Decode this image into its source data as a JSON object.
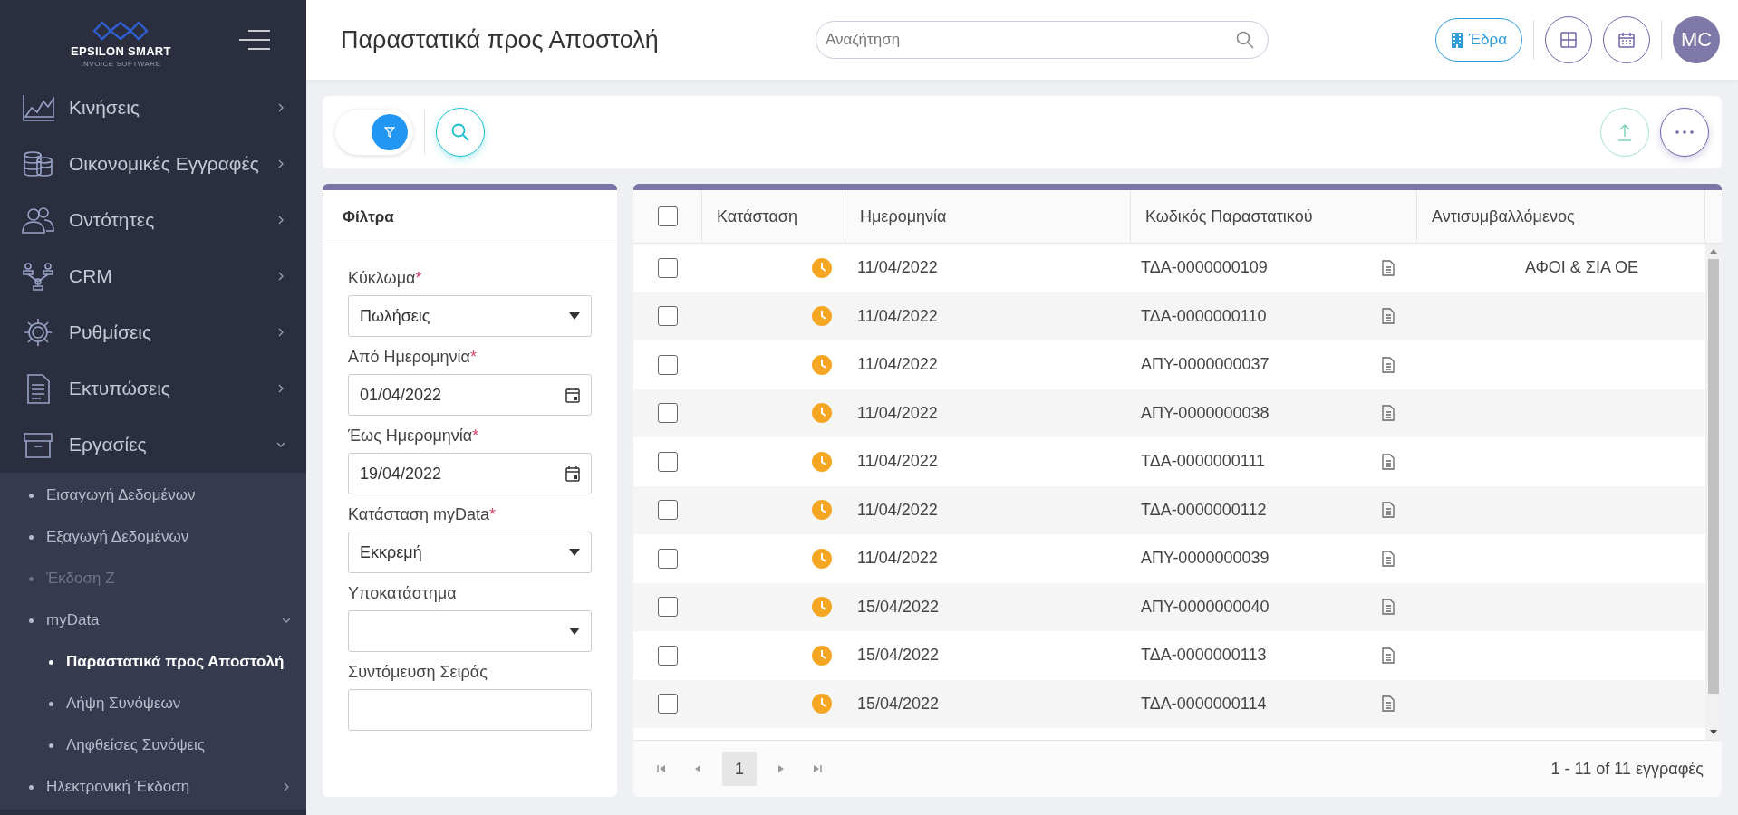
{
  "sidebar": {
    "logo": {
      "title": "EPSILON SMART",
      "subtitle": "INVOICE SOFTWARE"
    },
    "items": [
      {
        "label": "Κινήσεις",
        "kind": "chart",
        "expanded": false
      },
      {
        "label": "Οικονομικές Εγγραφές",
        "kind": "coins",
        "expanded": false
      },
      {
        "label": "Οντότητες",
        "kind": "people",
        "expanded": false
      },
      {
        "label": "CRM",
        "kind": "network",
        "expanded": false
      },
      {
        "label": "Ρυθμίσεις",
        "kind": "gear",
        "expanded": false
      },
      {
        "label": "Εκτυπώσεις",
        "kind": "document",
        "expanded": false
      },
      {
        "label": "Εργασίες",
        "kind": "archive",
        "expanded": true,
        "children": [
          {
            "label": "Εισαγωγή Δεδομένων",
            "disabled": false,
            "selected": false
          },
          {
            "label": "Εξαγωγή Δεδομένων",
            "disabled": false,
            "selected": false
          },
          {
            "label": "Έκδοση Ζ",
            "disabled": true,
            "selected": false
          },
          {
            "label": "myData",
            "disabled": false,
            "selected": false,
            "expanded": true,
            "children": [
              {
                "label": "Παραστατικά προς Αποστολή",
                "selected": true
              },
              {
                "label": "Λήψη Συνόψεων",
                "selected": false
              },
              {
                "label": "Ληφθείσες Συνόψεις",
                "selected": false
              }
            ]
          },
          {
            "label": "Ηλεκτρονική Έκδοση",
            "disabled": false,
            "selected": false,
            "expanded": false
          }
        ]
      }
    ]
  },
  "header": {
    "title": "Παραστατικά προς Αποστολή",
    "search": {
      "placeholder": "Αναζήτηση"
    },
    "branch_button": "Έδρα",
    "avatar": "MC"
  },
  "toolbar": {
    "filter_toggle": {
      "on": true
    }
  },
  "filters": {
    "title": "Φίλτρα",
    "fields": [
      {
        "kind": "select",
        "label": "Κύκλωμα",
        "required_mark": "*",
        "value": "Πωλήσεις"
      },
      {
        "kind": "date",
        "label": "Από Ημερομηνία",
        "required_mark": "*",
        "value": "01/04/2022"
      },
      {
        "kind": "date",
        "label": "Έως Ημερομηνία",
        "required_mark": "*",
        "value": "19/04/2022"
      },
      {
        "kind": "select",
        "label": "Κατάσταση myData",
        "required_mark": "*",
        "value": "Εκκρεμή"
      },
      {
        "kind": "select",
        "label": "Υποκατάστημα"
      },
      {
        "kind": "text",
        "label": "Συντόμευση Σειράς"
      }
    ]
  },
  "table": {
    "select_all": {
      "checked": false
    },
    "columns": [
      "Κατάσταση",
      "Ημερομηνία",
      "Κωδικός Παραστατικού",
      "Αντισυμβαλλόμενος"
    ],
    "rows": [
      {
        "checked": false,
        "kind": "pending",
        "date": "11/04/2022",
        "code": "ΤΔΑ-0000000109",
        "counterparty": "ΑΦΟΙ & ΣΙΑ ΟΕ"
      },
      {
        "checked": false,
        "kind": "pending",
        "date": "11/04/2022",
        "code": "ΤΔΑ-0000000110"
      },
      {
        "checked": false,
        "kind": "pending",
        "date": "11/04/2022",
        "code": "ΑΠΥ-0000000037"
      },
      {
        "checked": false,
        "kind": "pending",
        "date": "11/04/2022",
        "code": "ΑΠΥ-0000000038"
      },
      {
        "checked": false,
        "kind": "pending",
        "date": "11/04/2022",
        "code": "ΤΔΑ-0000000111"
      },
      {
        "checked": false,
        "kind": "pending",
        "date": "11/04/2022",
        "code": "ΤΔΑ-0000000112"
      },
      {
        "checked": false,
        "kind": "pending",
        "date": "11/04/2022",
        "code": "ΑΠΥ-0000000039"
      },
      {
        "checked": false,
        "kind": "pending",
        "date": "15/04/2022",
        "code": "ΑΠΥ-0000000040"
      },
      {
        "checked": false,
        "kind": "pending",
        "date": "15/04/2022",
        "code": "ΤΔΑ-0000000113"
      },
      {
        "checked": false,
        "kind": "pending",
        "date": "15/04/2022",
        "code": "ΤΔΑ-0000000114"
      }
    ],
    "pagination": {
      "pages": [
        {
          "label": "1",
          "selected": true
        }
      ],
      "info": "1 - 11 of 11 εγγραφές"
    }
  }
}
